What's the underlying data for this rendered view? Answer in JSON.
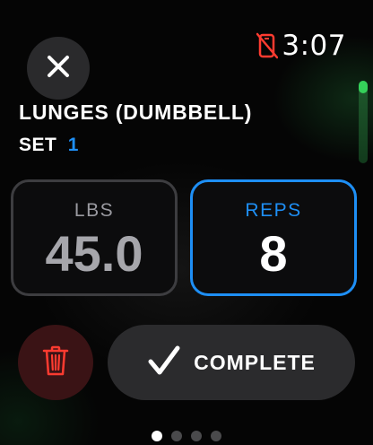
{
  "status": {
    "time": "3:07",
    "phone_icon": "phone-disconnected-icon",
    "phone_icon_color": "#ff3b30"
  },
  "header": {
    "close_icon": "close-icon",
    "exercise_title": "LUNGES (DUMBBELL)",
    "set_label": "SET",
    "set_number": "1"
  },
  "inputs": {
    "weight": {
      "label": "LBS",
      "value": "45.0"
    },
    "reps": {
      "label": "REPS",
      "value": "8",
      "selected": true
    }
  },
  "actions": {
    "delete_icon": "trash-icon",
    "complete_icon": "checkmark-icon",
    "complete_label": "COMPLETE"
  },
  "pagination": {
    "pages": 4,
    "current": 1
  },
  "scroll": {
    "position_fraction": 0.0
  },
  "colors": {
    "accent_blue": "#1e8ff5",
    "delete_red": "#ff3b30",
    "scroll_green": "#35d15a"
  }
}
